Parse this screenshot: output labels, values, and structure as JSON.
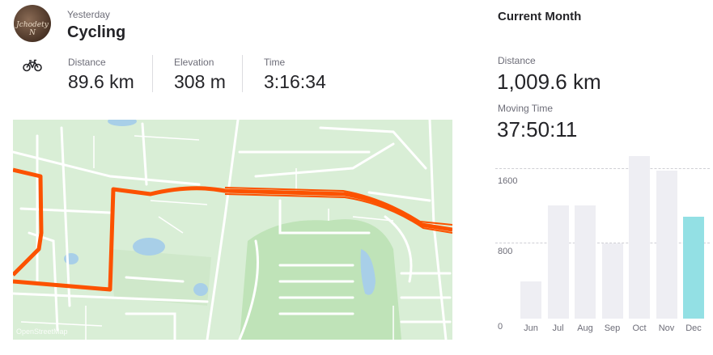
{
  "activity": {
    "when": "Yesterday",
    "type": "Cycling",
    "icon": "bicycle-icon",
    "stats": [
      {
        "label": "Distance",
        "value": "89.6 km"
      },
      {
        "label": "Elevation",
        "value": "308 m"
      },
      {
        "label": "Time",
        "value": "3:16:34"
      }
    ]
  },
  "map": {
    "route_color": "#fc5200",
    "attribution": "OpenStreetMap"
  },
  "current_month": {
    "title": "Current Month",
    "distance_label": "Distance",
    "distance_value": "1,009.6 km",
    "moving_time_label": "Moving Time",
    "moving_time_value": "37:50:11"
  },
  "chart_data": {
    "type": "bar",
    "categories": [
      "Jun",
      "Jul",
      "Aug",
      "Sep",
      "Oct",
      "Nov",
      "Dec"
    ],
    "values": [
      390,
      1190,
      1190,
      790,
      1710,
      1560,
      1070
    ],
    "yticks": [
      0,
      800,
      1600
    ],
    "ylim": [
      0,
      1800
    ],
    "highlight_index": 6,
    "colors": {
      "bar": "#eeeef3",
      "highlight": "#93e0e4"
    }
  }
}
